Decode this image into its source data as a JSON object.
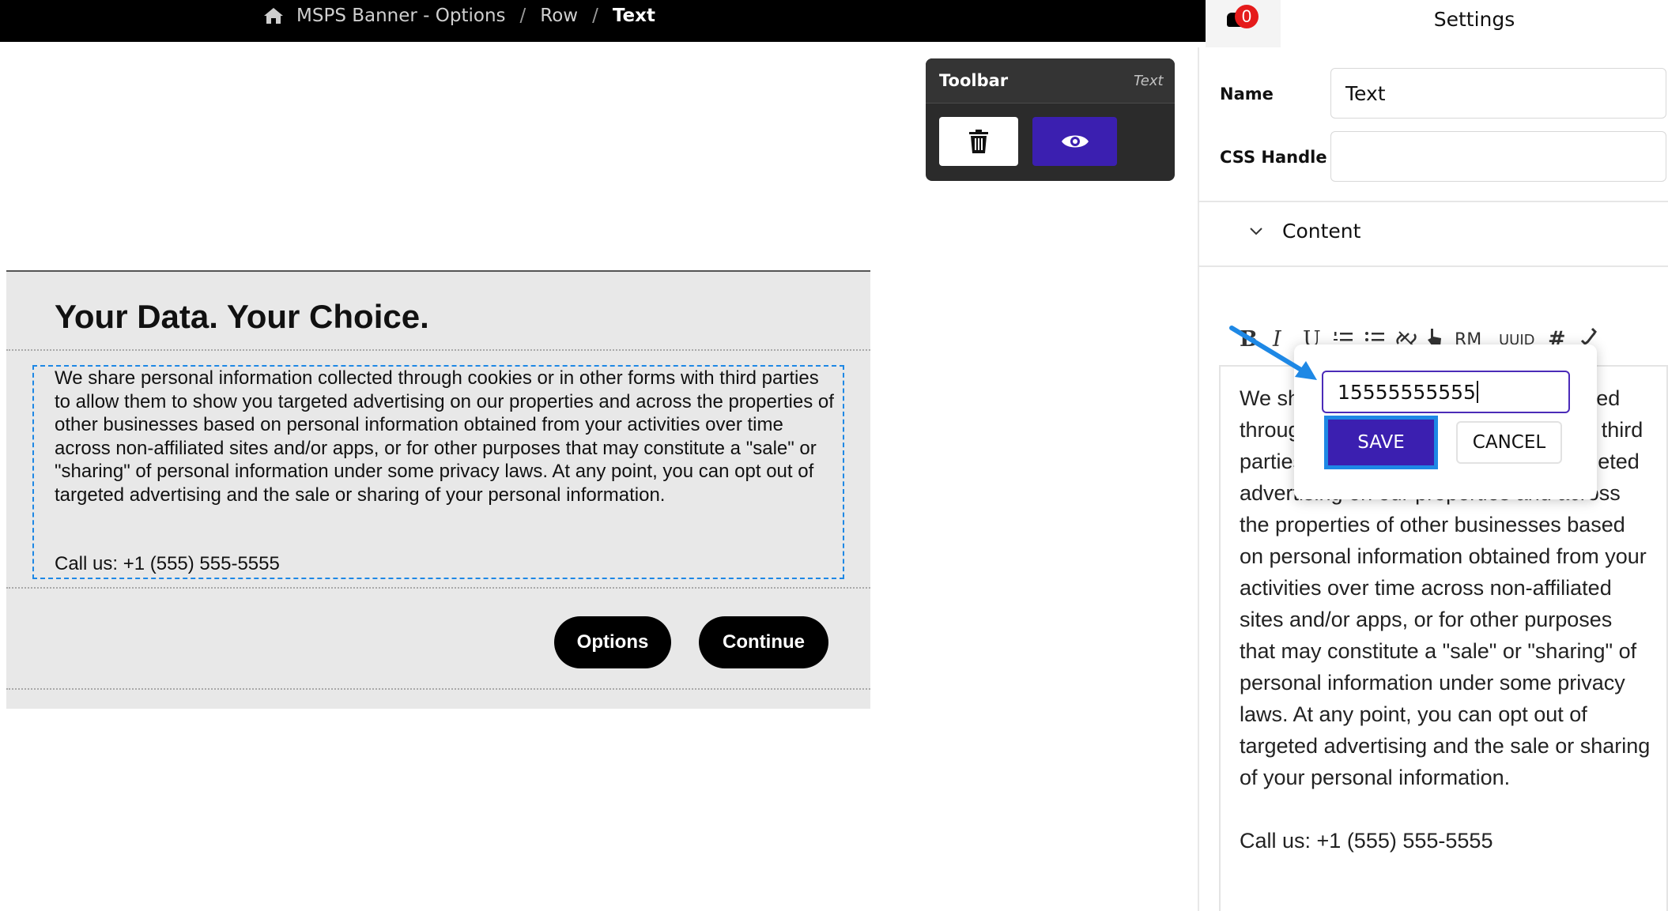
{
  "breadcrumb": {
    "items": [
      "MSPS Banner - Options",
      "Row",
      "Text"
    ],
    "separator": "/"
  },
  "notifications": {
    "count": "0"
  },
  "settings": {
    "title": "Settings",
    "name_label": "Name",
    "name_value": "Text",
    "css_label": "CSS Handle",
    "css_value": "",
    "content_label": "Content"
  },
  "editor": {
    "tools": [
      "B",
      "I",
      "U",
      "ordered-list",
      "bullet-list",
      "link",
      "pointer",
      "RM",
      "UUID",
      "#",
      "phone"
    ],
    "rm_label": "RM",
    "uuid_label": "UUID",
    "hash_label": "#",
    "text": "We share personal information collected through cookies or in other forms with third parties to allow them to show you targeted advertising on our properties and across the properties of other businesses based on personal information obtained from your activities over time across non-affiliated sites and/or apps, or for other purposes that may constitute a \"sale\" or \"sharing\" of personal information under some privacy laws. At any point, you can opt out of targeted advertising and the sale or sharing of your personal information.",
    "call": "Call us: +1 (555) 555-5555"
  },
  "popover": {
    "input_value": "15555555555",
    "save_label": "SAVE",
    "cancel_label": "CANCEL"
  },
  "toolbar": {
    "title": "Toolbar",
    "subtitle": "Text"
  },
  "banner": {
    "title": "Your Data. Your Choice.",
    "body": "We share personal information collected through cookies or in other forms with third parties to allow them to show you targeted advertising on our properties and across the properties of other businesses based on personal information obtained from your activities over time across non-affiliated sites and/or apps, or for other purposes that may constitute a \"sale\" or \"sharing\" of personal information under some privacy laws. At any point, you can opt out of targeted advertising and the sale or sharing of your personal information.",
    "call": "Call us: +1 (555) 555-5555",
    "options_label": "Options",
    "continue_label": "Continue"
  },
  "colors": {
    "accent_purple": "#3b1fb0",
    "selection_blue": "#1e88e5",
    "badge_red": "#e51b1b"
  }
}
